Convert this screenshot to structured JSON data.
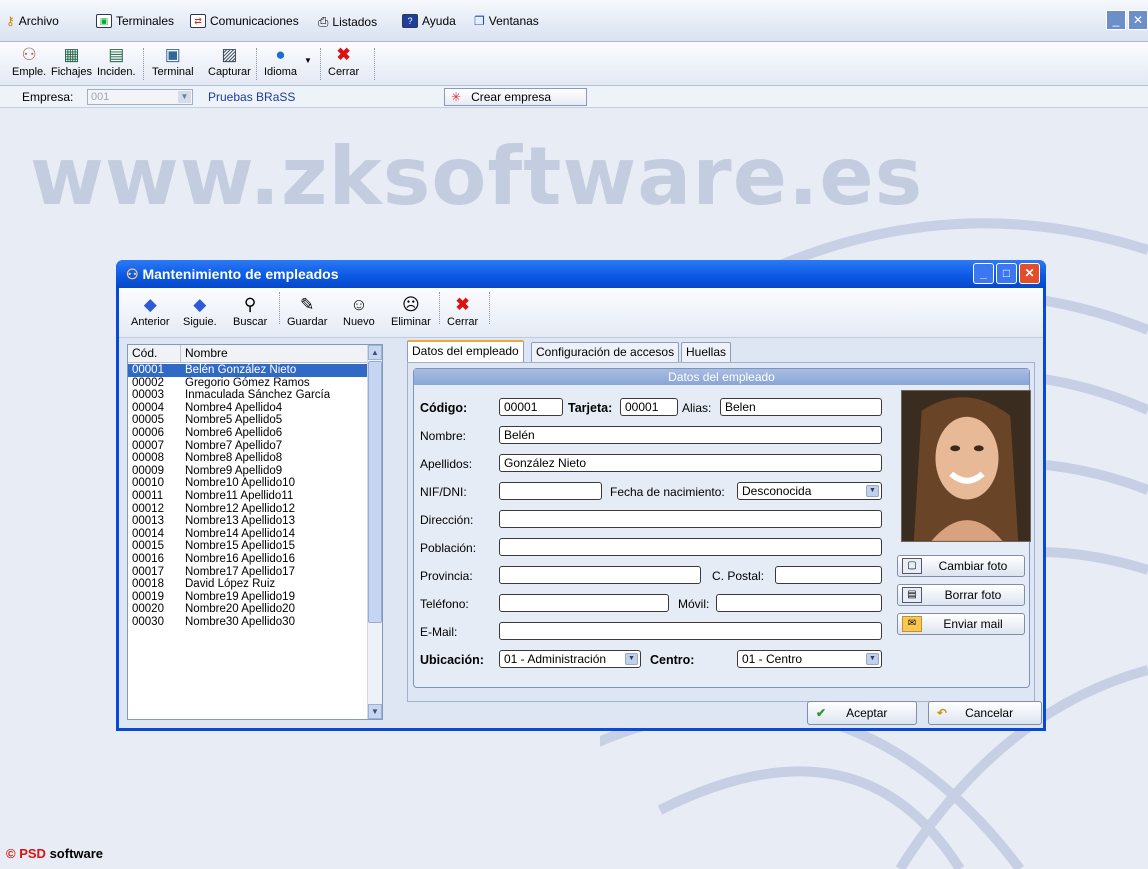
{
  "menu": [
    "Archivo",
    "Terminales",
    "Comunicaciones",
    "Listados",
    "Ayuda",
    "Ventanas"
  ],
  "toolbar": {
    "items": [
      "Emple.",
      "Fichajes",
      "Inciden.",
      "Terminal",
      "Capturar",
      "Idioma",
      "Cerrar"
    ]
  },
  "empresa": {
    "label": "Empresa:",
    "code": "001",
    "name": "Pruebas BRaSS",
    "create_button": "Crear empresa"
  },
  "watermark": "www.zksoftware.es",
  "footer": {
    "copyright": "©",
    "brand": "PSD",
    "suffix": "software"
  },
  "dialog": {
    "title": "Mantenimiento de empleados",
    "toolbar": [
      "Anterior",
      "Siguie.",
      "Buscar",
      "Guardar",
      "Nuevo",
      "Eliminar",
      "Cerrar"
    ],
    "list": {
      "headers": [
        "Cód.",
        "Nombre"
      ],
      "rows": [
        [
          "00001",
          "Belén González Nieto"
        ],
        [
          "00002",
          "Gregorio Gómez Ramos"
        ],
        [
          "00003",
          "Inmaculada Sánchez García"
        ],
        [
          "00004",
          "Nombre4 Apellido4"
        ],
        [
          "00005",
          "Nombre5 Apellido5"
        ],
        [
          "00006",
          "Nombre6 Apellido6"
        ],
        [
          "00007",
          "Nombre7 Apellido7"
        ],
        [
          "00008",
          "Nombre8 Apellido8"
        ],
        [
          "00009",
          "Nombre9 Apellido9"
        ],
        [
          "00010",
          "Nombre10 Apellido10"
        ],
        [
          "00011",
          "Nombre11 Apellido11"
        ],
        [
          "00012",
          "Nombre12 Apellido12"
        ],
        [
          "00013",
          "Nombre13 Apellido13"
        ],
        [
          "00014",
          "Nombre14 Apellido14"
        ],
        [
          "00015",
          "Nombre15 Apellido15"
        ],
        [
          "00016",
          "Nombre16 Apellido16"
        ],
        [
          "00017",
          "Nombre17 Apellido17"
        ],
        [
          "00018",
          "David López Ruiz"
        ],
        [
          "00019",
          "Nombre19 Apellido19"
        ],
        [
          "00020",
          "Nombre20 Apellido20"
        ],
        [
          "00030",
          "Nombre30 Apellido30"
        ]
      ]
    },
    "tabs": [
      "Datos del empleado",
      "Configuración de accesos",
      "Huellas"
    ],
    "section_title": "Datos del empleado",
    "form": {
      "codigo_label": "Código:",
      "codigo": "00001",
      "tarjeta_label": "Tarjeta:",
      "tarjeta": "00001",
      "alias_label": "Alias:",
      "alias": "Belen",
      "nombre_label": "Nombre:",
      "nombre": "Belén",
      "apellidos_label": "Apellidos:",
      "apellidos": "González Nieto",
      "nif_label": "NIF/DNI:",
      "nif": "",
      "fecha_label": "Fecha de nacimiento:",
      "fecha": "Desconocida",
      "direccion_label": "Dirección:",
      "poblacion_label": "Población:",
      "provincia_label": "Provincia:",
      "cpostal_label": "C. Postal:",
      "telefono_label": "Teléfono:",
      "movil_label": "Móvil:",
      "email_label": "E-Mail:",
      "ubicacion_label": "Ubicación:",
      "ubicacion": "01 - Administración",
      "centro_label": "Centro:",
      "centro": "01 - Centro"
    },
    "photo_buttons": [
      "Cambiar foto",
      "Borrar foto",
      "Enviar mail"
    ],
    "aceptar": "Aceptar",
    "cancelar": "Cancelar"
  }
}
